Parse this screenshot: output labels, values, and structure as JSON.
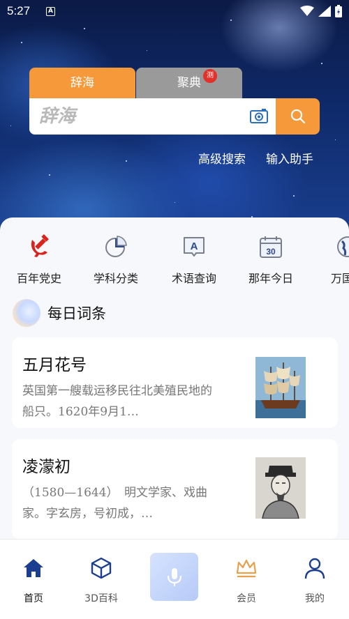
{
  "status_bar": {
    "time": "5:27",
    "badge": "A"
  },
  "search": {
    "tabs": [
      {
        "label": "辞海",
        "active": true
      },
      {
        "label": "聚典",
        "active": false,
        "badge": "测"
      }
    ],
    "placeholder": "辞海",
    "links": [
      "高级搜索",
      "输入助手"
    ]
  },
  "categories": [
    {
      "label": "百年党史",
      "icon": "party-emblem-icon"
    },
    {
      "label": "学科分类",
      "icon": "pie-chart-icon"
    },
    {
      "label": "术语查询",
      "icon": "term-query-icon"
    },
    {
      "label": "那年今日",
      "icon": "calendar-icon"
    },
    {
      "label": "万国",
      "icon": "globe-icon"
    }
  ],
  "daily": {
    "title": "每日词条",
    "entries": [
      {
        "title": "五月花号",
        "description": "英国第一艘载运移民往北美殖民地的船只。1620年9月1…",
        "thumb": "sailing-ship"
      },
      {
        "title": "凌濛初",
        "description": "（1580—1644）　明文学家、戏曲家。字玄房，号初成，…",
        "thumb": "portrait"
      }
    ]
  },
  "bottom_nav": [
    {
      "label": "首页",
      "icon": "home-icon",
      "active": true
    },
    {
      "label": "3D百科",
      "icon": "cube-icon",
      "active": false
    },
    {
      "label": "",
      "icon": "microphone-icon",
      "active": false
    },
    {
      "label": "会员",
      "icon": "crown-icon",
      "active": false
    },
    {
      "label": "我的",
      "icon": "person-icon",
      "active": false
    }
  ],
  "colors": {
    "accent": "#f5993a",
    "nav_blue": "#1a3d8f",
    "tab_inactive": "#9a9a9a"
  }
}
